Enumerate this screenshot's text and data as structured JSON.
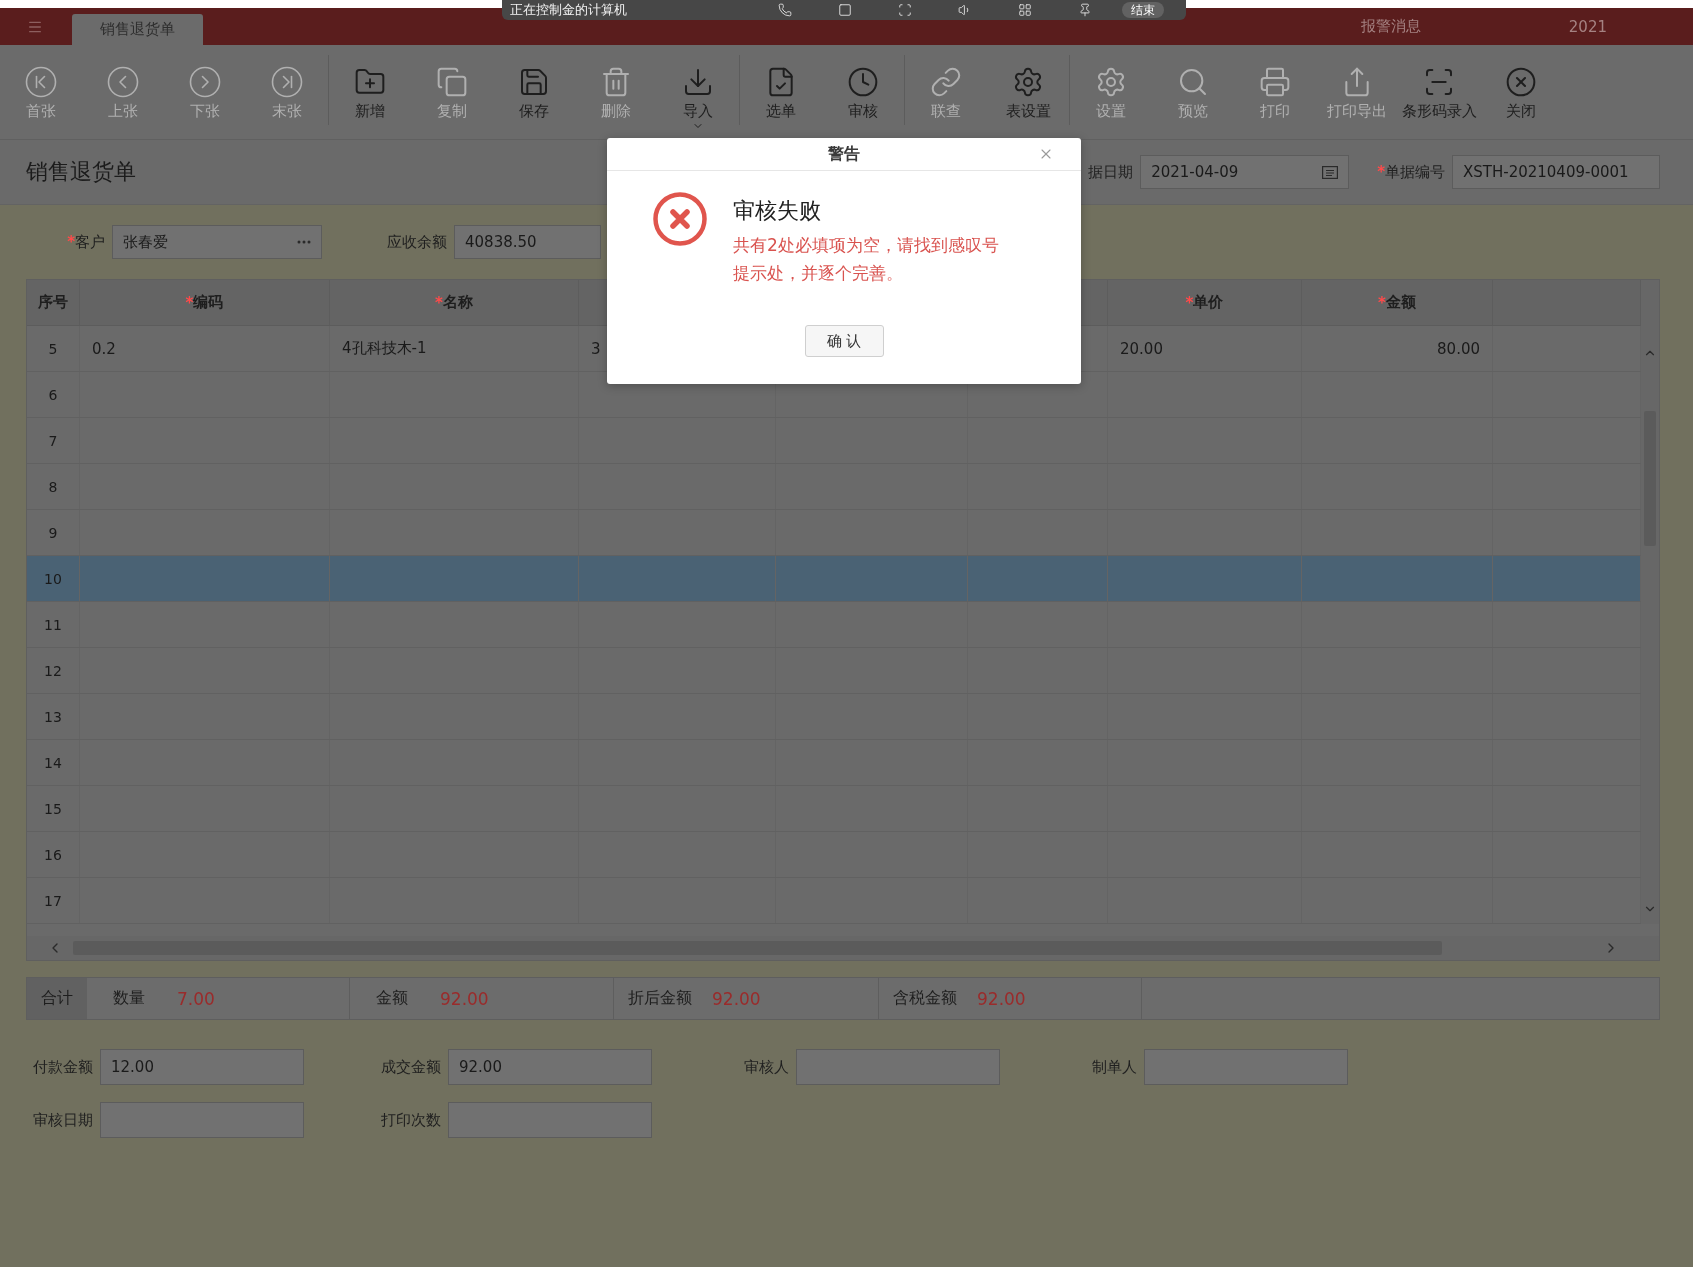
{
  "remote_bar": {
    "title": "正在控制金的计算机",
    "end_button": "结束"
  },
  "title_bar": {
    "tabs": [
      {
        "label": "销售退货单",
        "selected": true
      }
    ],
    "alarm": "报警消息",
    "year": "2021"
  },
  "toolbar": {
    "groups": [
      {
        "buttons": [
          {
            "label": "首张",
            "kind": "button",
            "disabled": true
          },
          {
            "label": "上张",
            "kind": "button",
            "disabled": true
          },
          {
            "label": "下张",
            "kind": "button",
            "disabled": true
          },
          {
            "label": "末张",
            "kind": "button",
            "disabled": true
          }
        ]
      },
      {
        "buttons": [
          {
            "label": "新增",
            "kind": "button",
            "disabled": false
          },
          {
            "label": "复制",
            "kind": "button",
            "disabled": true
          },
          {
            "label": "保存",
            "kind": "button",
            "disabled": false
          },
          {
            "label": "删除",
            "kind": "button",
            "disabled": true
          },
          {
            "label": "导入",
            "kind": "menu",
            "disabled": false
          }
        ]
      },
      {
        "buttons": [
          {
            "label": "选单",
            "kind": "button",
            "disabled": false
          },
          {
            "label": "审核",
            "kind": "button",
            "disabled": false
          }
        ]
      },
      {
        "buttons": [
          {
            "label": "联查",
            "kind": "button",
            "disabled": true
          },
          {
            "label": "表设置",
            "kind": "button",
            "disabled": false
          }
        ]
      },
      {
        "buttons": [
          {
            "label": "设置",
            "kind": "button",
            "disabled": true
          },
          {
            "label": "预览",
            "kind": "button",
            "disabled": true
          },
          {
            "label": "打印",
            "kind": "button",
            "disabled": true
          },
          {
            "label": "打印导出",
            "kind": "button",
            "disabled": true
          },
          {
            "label": "条形码录入",
            "kind": "button",
            "disabled": false
          },
          {
            "label": "关闭",
            "kind": "button",
            "disabled": false
          }
        ]
      }
    ]
  },
  "form": {
    "title": "销售退货单",
    "date": {
      "label": "据日期",
      "value": "2021-04-09"
    },
    "number": {
      "required_mark": "*",
      "label": "单据编号",
      "value": "XSTH-20210409-0001"
    },
    "customer": {
      "required_mark": "*",
      "label": "客户",
      "value": "张春爱"
    },
    "receivable": {
      "label": "应收余额",
      "value": "40838.50"
    }
  },
  "table": {
    "columns": {
      "no": {
        "label": "序号"
      },
      "code": {
        "required_mark": "*",
        "label": "编码"
      },
      "name": {
        "required_mark": "*",
        "label": "名称"
      },
      "unit_price": {
        "required_mark": "*",
        "label": "单价"
      },
      "amount": {
        "required_mark": "*",
        "label": "金额"
      }
    },
    "rows": [
      {
        "no": "5",
        "code": "0.2",
        "name": "4孔科技木-1",
        "column_4": "3",
        "unit_price": "20.00",
        "amount": "80.00",
        "selected": false
      },
      {
        "no": "6",
        "selected": false
      },
      {
        "no": "7",
        "selected": false
      },
      {
        "no": "8",
        "selected": false
      },
      {
        "no": "9",
        "selected": false
      },
      {
        "no": "10",
        "selected": true
      },
      {
        "no": "11",
        "selected": false
      },
      {
        "no": "12",
        "selected": false
      },
      {
        "no": "13",
        "selected": false
      },
      {
        "no": "14",
        "selected": false
      },
      {
        "no": "15",
        "selected": false
      },
      {
        "no": "16",
        "selected": false
      },
      {
        "no": "17",
        "selected": false
      }
    ]
  },
  "summary": {
    "label": "合计",
    "items": [
      {
        "label": "数量",
        "value": "7.00"
      },
      {
        "label": "金额",
        "value": "92.00"
      },
      {
        "label": "折后金额",
        "value": "92.00"
      },
      {
        "label": "含税金额",
        "value": "92.00"
      }
    ]
  },
  "footer_fields": [
    {
      "label": "付款金额",
      "value": "12.00"
    },
    {
      "label": "成交金额",
      "value": "92.00"
    },
    {
      "label": "审核人"
    },
    {
      "label": "制单人"
    },
    {
      "label": "审核日期"
    },
    {
      "label": "打印次数"
    }
  ],
  "dialog": {
    "title": "警告",
    "heading": "审核失败",
    "message": "共有2处必填项为空，请找到感叹号提示处，并逐个完善。",
    "button": "确 认"
  }
}
